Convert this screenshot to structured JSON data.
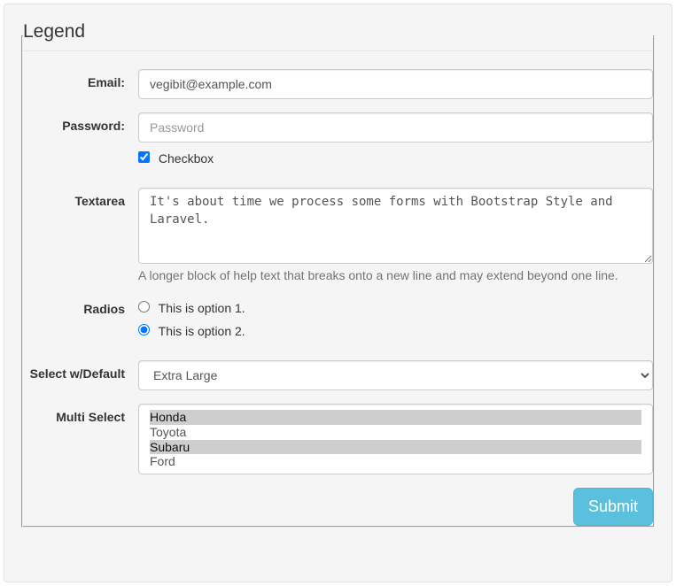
{
  "legend": "Legend",
  "email": {
    "label": "Email:",
    "value": "vegibit@example.com"
  },
  "password": {
    "label": "Password:",
    "placeholder": "Password"
  },
  "checkbox": {
    "label": "Checkbox",
    "checked": true
  },
  "textarea": {
    "label": "Textarea",
    "value": "It's about time we process some forms with Bootstrap Style and Laravel.",
    "help": "A longer block of help text that breaks onto a new line and may extend beyond one line."
  },
  "radios": {
    "label": "Radios",
    "options": [
      "This is option 1.",
      "This is option 2."
    ],
    "selected": 1
  },
  "select": {
    "label": "Select w/Default",
    "value": "Extra Large"
  },
  "multiselect": {
    "label": "Multi Select",
    "options": [
      "Honda",
      "Toyota",
      "Subaru",
      "Ford"
    ],
    "selected": [
      "Honda",
      "Subaru"
    ]
  },
  "submit": "Submit"
}
